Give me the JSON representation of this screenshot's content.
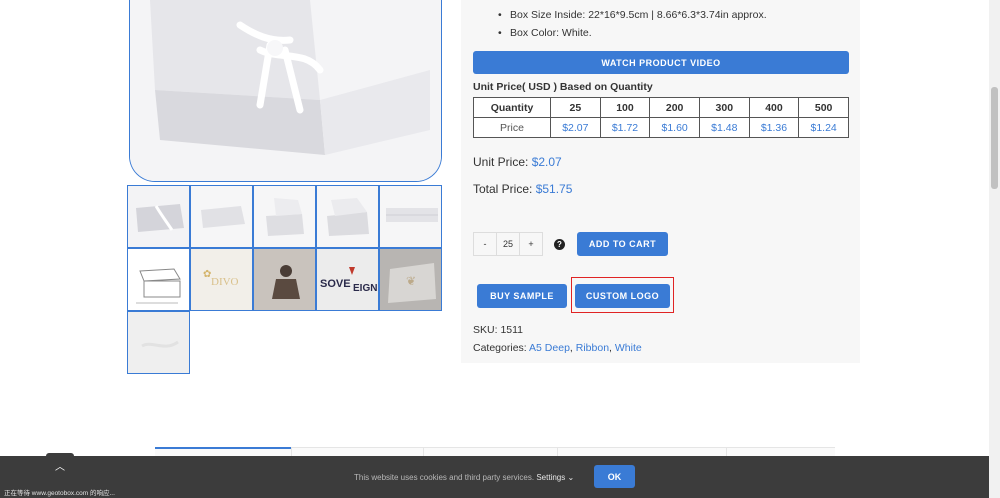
{
  "product": {
    "bullets": [
      "Box Size Inside: 22*16*9.5cm | 8.66*6.3*3.74in approx.",
      "Box Color: White."
    ],
    "watch_video_label": "WATCH PRODUCT VIDEO",
    "unit_price_heading": "Unit Price( USD ) Based on Quantity",
    "price_table": {
      "row_labels": [
        "Quantity",
        "Price"
      ],
      "quantities": [
        "25",
        "100",
        "200",
        "300",
        "400",
        "500"
      ],
      "prices": [
        "$2.07",
        "$1.72",
        "$1.60",
        "$1.48",
        "$1.36",
        "$1.24"
      ]
    },
    "unit_price_label": "Unit Price:",
    "unit_price_value": "$2.07",
    "total_price_label": "Total Price:",
    "total_price_value": "$51.75",
    "quantity": {
      "minus": "-",
      "value": "25",
      "plus": "+"
    },
    "help_icon": "question-circle-icon",
    "add_to_cart_label": "ADD TO CART",
    "buy_sample_label": "BUY SAMPLE",
    "custom_logo_label": "CUSTOM LOGO",
    "sku_label": "SKU:",
    "sku_value": "1511",
    "categories_label": "Categories:",
    "categories": [
      "A5 Deep",
      "Ribbon",
      "White"
    ]
  },
  "cookie_bar": {
    "text": "This website uses cookies and third party services.",
    "settings_label": "Settings",
    "ok_label": "OK"
  },
  "back_to_top_icon": "chevron-up-icon",
  "status_bar_text": "正在等待 www.geotobox.com 的响应...",
  "colors": {
    "accent": "#3a7bd5",
    "highlight_border": "#e02424",
    "cookie_bar_bg": "#3c3c3c"
  }
}
